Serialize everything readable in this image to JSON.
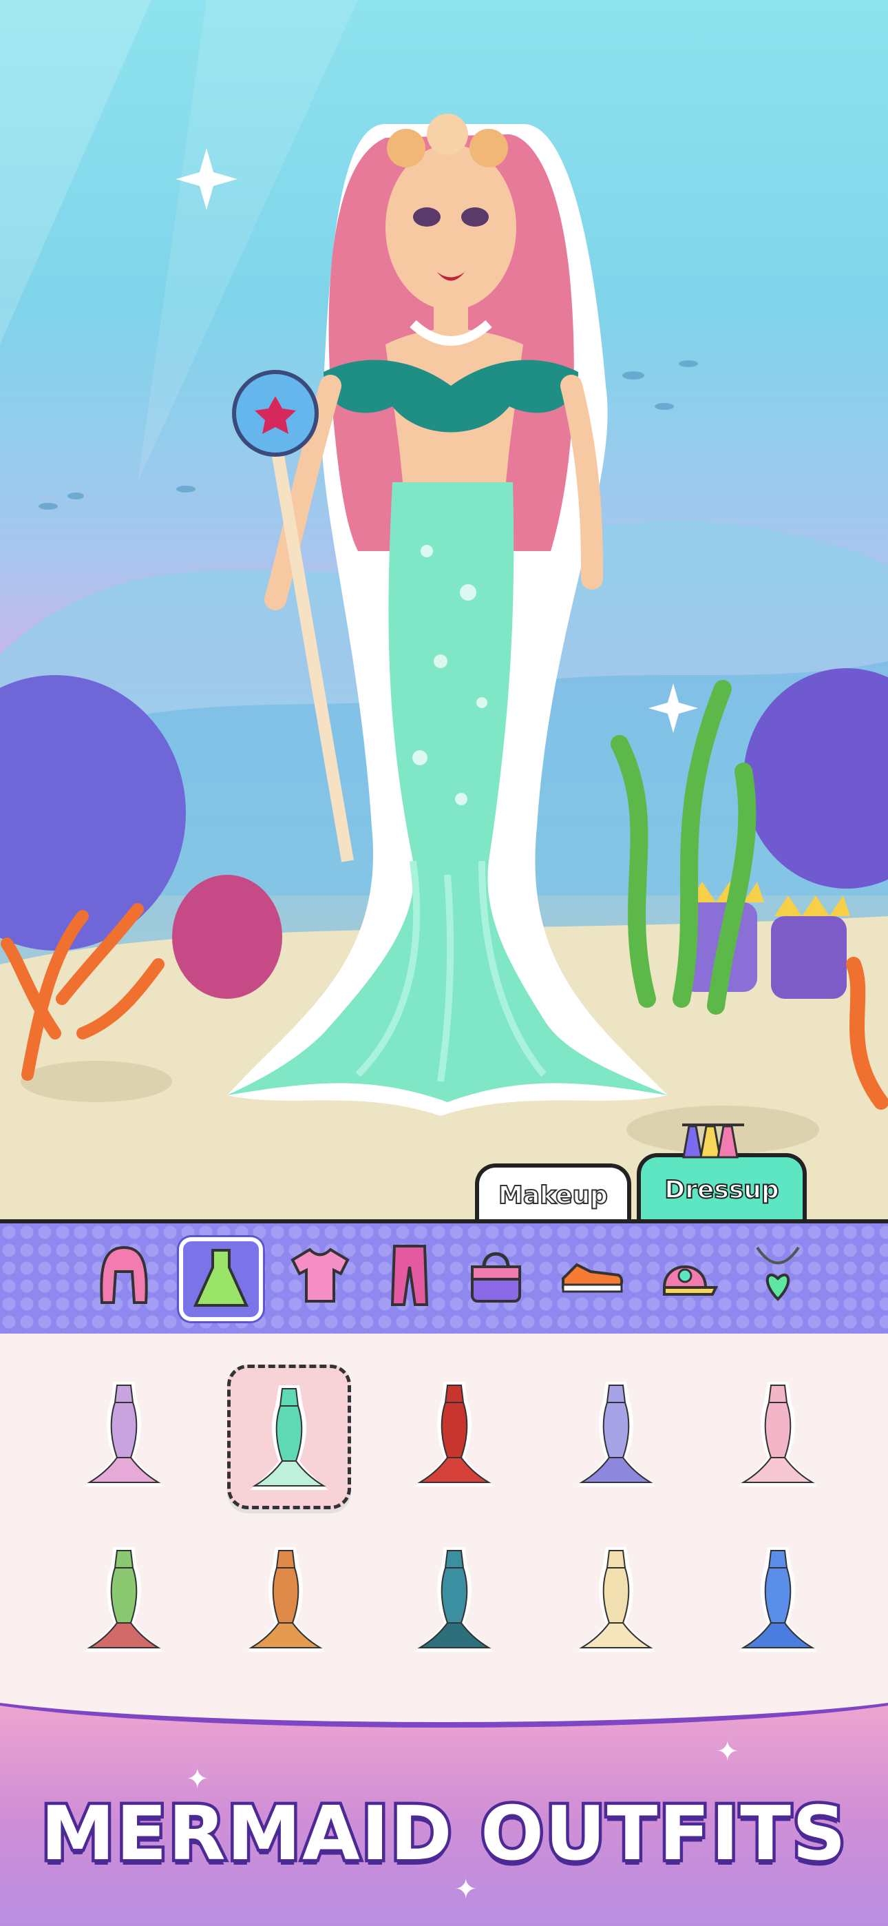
{
  "tabs": {
    "makeup": "Makeup",
    "dressup": "Dressup",
    "active": "Dressup"
  },
  "categories": [
    {
      "name": "hair",
      "icon": "wig-icon",
      "active": false
    },
    {
      "name": "dress",
      "icon": "dress-icon",
      "active": true
    },
    {
      "name": "top",
      "icon": "tshirt-icon",
      "active": false
    },
    {
      "name": "pants",
      "icon": "pants-icon",
      "active": false
    },
    {
      "name": "bag",
      "icon": "handbag-icon",
      "active": false
    },
    {
      "name": "shoes",
      "icon": "sneaker-icon",
      "active": false
    },
    {
      "name": "hat",
      "icon": "cap-icon",
      "active": false
    },
    {
      "name": "necklace",
      "icon": "necklace-icon",
      "active": false
    }
  ],
  "outfits": [
    {
      "color": "#c9a3e0",
      "tail": "#e6a9d8",
      "selected": false
    },
    {
      "color": "#5fd9b3",
      "tail": "#bff0dc",
      "selected": true
    },
    {
      "color": "#c8352f",
      "tail": "#d6423a",
      "selected": false
    },
    {
      "color": "#a6a3e6",
      "tail": "#8d87dd",
      "selected": false
    },
    {
      "color": "#f3b6c8",
      "tail": "#f7c7d3",
      "selected": false
    },
    {
      "color": "#8bc872",
      "tail": "#d36a6a",
      "selected": false
    },
    {
      "color": "#e08a4a",
      "tail": "#e59b4f",
      "selected": false
    },
    {
      "color": "#3b8fa0",
      "tail": "#2e6f7c",
      "selected": false
    },
    {
      "color": "#f1dfb0",
      "tail": "#f5e6bd",
      "selected": false
    },
    {
      "color": "#5b8ee8",
      "tail": "#4a7dde",
      "selected": false
    }
  ],
  "colors": {
    "accent": "#5ee6c3",
    "bar": "#8f89ef",
    "banner_text_stroke": "#4b2a95"
  },
  "banner": {
    "title": "MERMAID OUTFITS"
  }
}
